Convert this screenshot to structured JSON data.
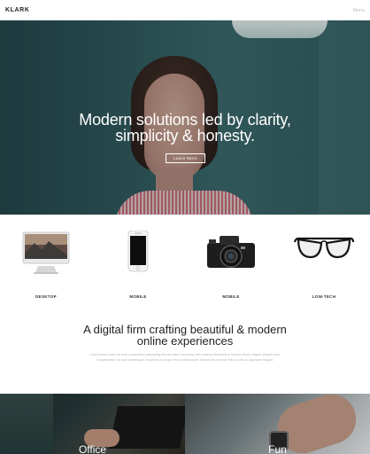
{
  "header": {
    "logo": "KLARK",
    "menu": "Menu"
  },
  "hero": {
    "title_line1": "Modern solutions led by clarity,",
    "title_line2": "simplicity & honesty.",
    "button": "Learn More"
  },
  "devices": [
    {
      "label": "DESKTOP",
      "icon": "imac-icon"
    },
    {
      "label": "MOBILE",
      "icon": "iphone-icon"
    },
    {
      "label": "MOBILE",
      "icon": "camera-icon"
    },
    {
      "label": "LOW-TECH",
      "icon": "glasses-icon"
    }
  ],
  "intro": {
    "title_line1": "A digital firm crafting beautiful & modern",
    "title_line2": "online experiences",
    "body_line1": "Lorem ipsum dolor sit amet consectetur adipiscing elit sed diam nonummy nibh euismod tincidunt ut laoreet dolore magna aliquam erat.",
    "body_line2": "Suspendisse nisi quis scelerisque nonummy a congue est in ullamcorper. Maecenas sit amet felis ac nisi eu dignissim feugiat."
  },
  "tiles": [
    {
      "label": "Office"
    },
    {
      "label": "Fun"
    }
  ]
}
